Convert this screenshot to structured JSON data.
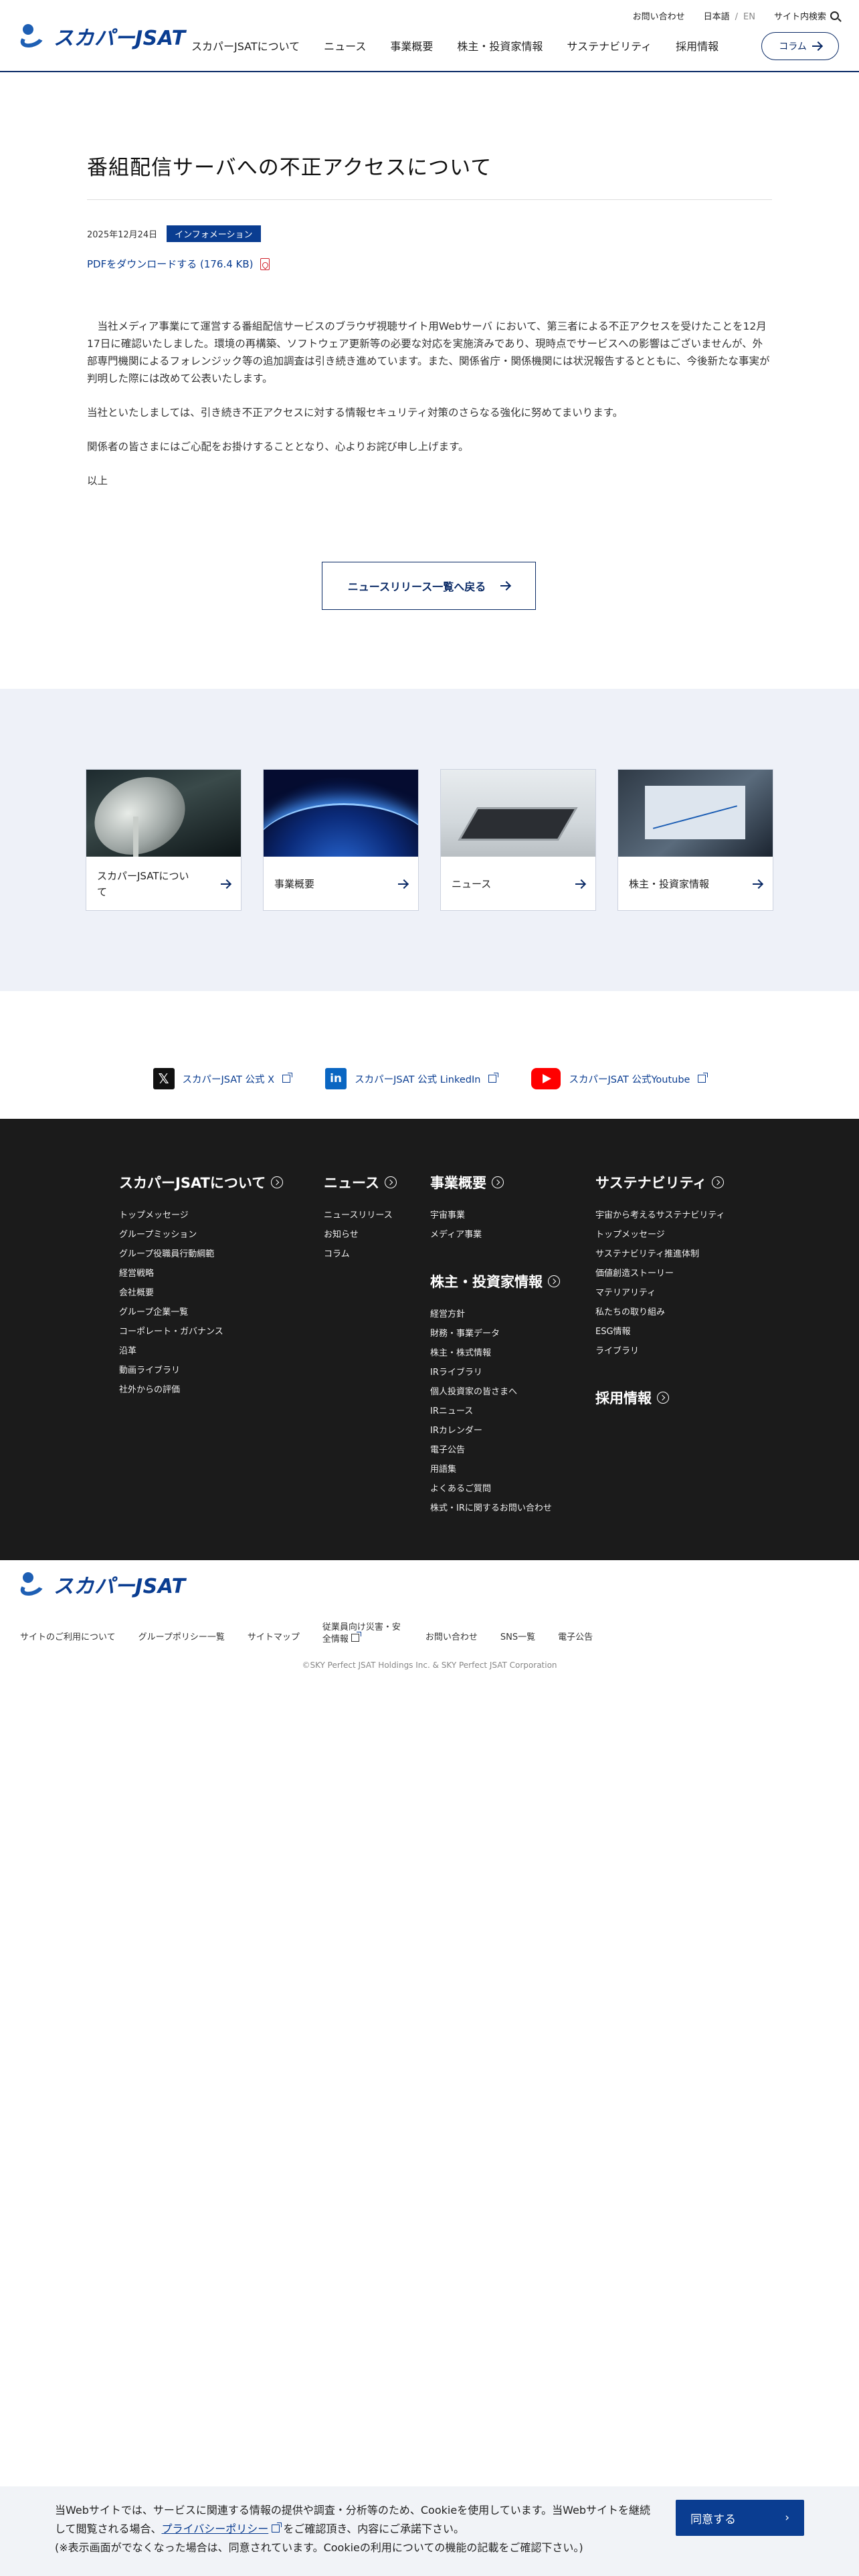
{
  "header": {
    "logo_text": "スカパーJSAT",
    "util": {
      "contact": "お問い合わせ",
      "lang_ja": "日本語",
      "lang_sep": "/",
      "lang_en": "EN",
      "search": "サイト内検索"
    },
    "nav": [
      "スカパーJSATについて",
      "ニュース",
      "事業概要",
      "株主・投資家情報",
      "サステナビリティ",
      "採用情報"
    ],
    "column_button": "コラム"
  },
  "article": {
    "title": "番組配信サーバへの不正アクセスについて",
    "date": "2025年12月24日",
    "category": "インフォメーション",
    "pdf_link": "PDFをダウンロードする (176.4 KB)",
    "paragraphs": [
      "　当社メディア事業にて運営する番組配信サービスのブラウザ視聴サイト用Webサーバ において、第三者による不正アクセスを受けたことを12月17日に確認いたしました。環境の再構築、ソフトウェア更新等の必要な対応を実施済みであり、現時点でサービスへの影響はございませんが、外部専門機関によるフォレンジック等の追加調査は引き続き進めています。また、関係省庁・関係機関には状況報告するとともに、今後新たな事実が判明した際には改めて公表いたします。",
      "当社といたしましては、引き続き不正アクセスに対する情報セキュリティ対策のさらなる強化に努めてまいります。",
      "関係者の皆さまにはご心配をお掛けすることとなり、心よりお詫び申し上げます。",
      "以上"
    ],
    "back_button": "ニュースリリース一覧へ戻る"
  },
  "cards": [
    {
      "label": "スカパーJSATについて",
      "image": "satellite-dish"
    },
    {
      "label": "事業概要",
      "image": "earth-from-space"
    },
    {
      "label": "ニュース",
      "image": "tablet-on-desk"
    },
    {
      "label": "株主・投資家情報",
      "image": "chart-on-laptop"
    }
  ],
  "social": [
    {
      "label": "スカパーJSAT 公式 X",
      "icon": "x-icon"
    },
    {
      "label": "スカパーJSAT 公式 LinkedIn",
      "icon": "linkedin-icon"
    },
    {
      "label": "スカパーJSAT 公式Youtube",
      "icon": "youtube-icon"
    }
  ],
  "footer": {
    "about": {
      "head": "スカパーJSATについて",
      "items": [
        "トップメッセージ",
        "グループミッション",
        "グループ役職員行動綱範",
        "経営戦略",
        "会社概要",
        "グループ企業一覧",
        "コーポレート・ガバナンス",
        "沿革",
        "動画ライブラリ",
        "社外からの評価"
      ]
    },
    "news": {
      "head": "ニュース",
      "items": [
        "ニュースリリース",
        "お知らせ",
        "コラム"
      ]
    },
    "business": {
      "head": "事業概要",
      "items": [
        "宇宙事業",
        "メディア事業"
      ]
    },
    "ir": {
      "head": "株主・投資家情報",
      "items": [
        "経営方針",
        "財務・事業データ",
        "株主・株式情報",
        "IRライブラリ",
        "個人投資家の皆さまへ",
        "IRニュース",
        "IRカレンダー",
        "電子公告",
        "用語集",
        "よくあるご質問",
        "株式・IRに関するお問い合わせ"
      ]
    },
    "sustainability": {
      "head": "サステナビリティ",
      "items": [
        "宇宙から考えるサステナビリティ",
        "トップメッセージ",
        "サステナビリティ推進体制",
        "価値創造ストーリー",
        "マテリアリティ",
        "私たちの取り組み",
        "ESG情報",
        "ライブラリ"
      ]
    },
    "recruit": {
      "head": "採用情報"
    }
  },
  "bottom": {
    "logo_text": "スカパーJSAT",
    "links": [
      "サイトのご利用について",
      "グループポリシー一覧",
      "サイトマップ",
      "従業員向け災害・安全情報",
      "お問い合わせ",
      "SNS一覧",
      "電子公告"
    ],
    "copyright": "©SKY Perfect JSAT Holdings Inc. & SKY Perfect JSAT Corporation"
  },
  "cookie": {
    "text1": "当Webサイトでは、サービスに関連する情報の提供や調査・分析等のため、Cookieを使用しています。当Webサイトを継続して閲覧される場合、",
    "policy_link": "プライバシーポリシー",
    "text2": "をご確認頂き、内容にご承諾下さい。",
    "text3": "(※表示画面がでなくなった場合は、同意されています。Cookieの利用についての機能の記載をご確認下さい。)",
    "agree": "同意する"
  },
  "colors": {
    "brand": "#0a3d91",
    "dark_footer": "#1b1b1b",
    "cards_bg": "#eef1f8"
  }
}
